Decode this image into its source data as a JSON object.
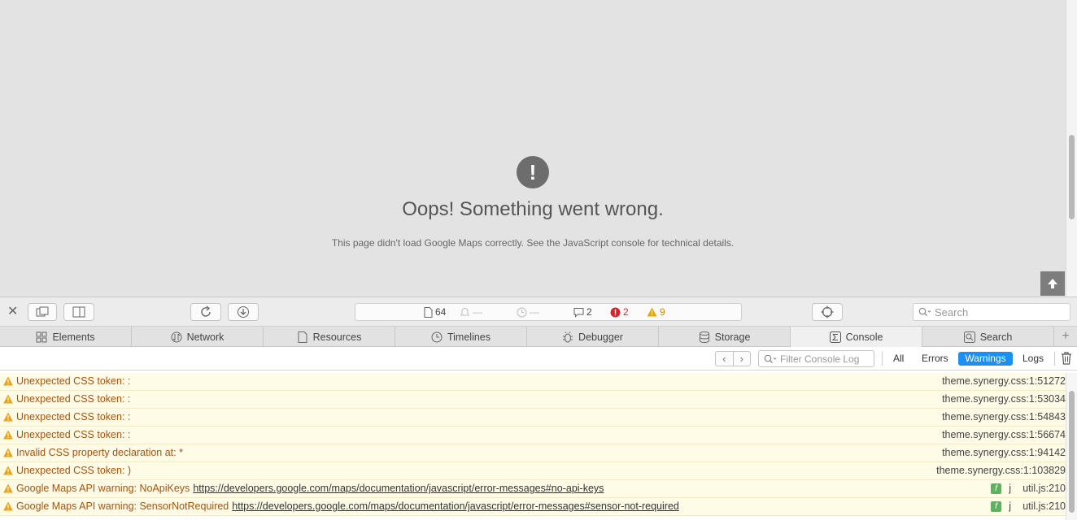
{
  "page": {
    "error_icon": "!",
    "error_title": "Oops! Something went wrong.",
    "error_description": "This page didn't load Google Maps correctly. See the JavaScript console for technical details."
  },
  "toolbar": {
    "resources_count": "64",
    "network_value": "—",
    "load_time_value": "—",
    "logs_count": "2",
    "errors_count": "2",
    "warnings_count": "9",
    "search_placeholder": "Search"
  },
  "tabs": [
    {
      "label": "Elements",
      "icon": "elements-icon"
    },
    {
      "label": "Network",
      "icon": "network-icon"
    },
    {
      "label": "Resources",
      "icon": "resources-icon"
    },
    {
      "label": "Timelines",
      "icon": "timelines-icon"
    },
    {
      "label": "Debugger",
      "icon": "debugger-icon"
    },
    {
      "label": "Storage",
      "icon": "storage-icon"
    },
    {
      "label": "Console",
      "icon": "console-icon",
      "active": true
    },
    {
      "label": "Search",
      "icon": "search-icon"
    }
  ],
  "filter": {
    "placeholder": "Filter Console Log",
    "scopes": [
      "All",
      "Errors",
      "Warnings",
      "Logs"
    ],
    "active_scope": "Warnings"
  },
  "messages": [
    {
      "text": "Unexpected CSS token: :",
      "source": "theme.synergy.css:1:51272"
    },
    {
      "text": "Unexpected CSS token: :",
      "source": "theme.synergy.css:1:53034"
    },
    {
      "text": "Unexpected CSS token: :",
      "source": "theme.synergy.css:1:54843"
    },
    {
      "text": "Unexpected CSS token: :",
      "source": "theme.synergy.css:1:56674"
    },
    {
      "text": "Invalid CSS property declaration at: *",
      "source": "theme.synergy.css:1:94142"
    },
    {
      "text": "Unexpected CSS token: )",
      "source": "theme.synergy.css:1:103829"
    },
    {
      "text": "Google Maps API warning: NoApiKeys",
      "link": "https://developers.google.com/maps/documentation/javascript/error-messages#no-api-keys",
      "function": "j",
      "source": "util.js:210"
    },
    {
      "text": "Google Maps API warning: SensorNotRequired",
      "link": "https://developers.google.com/maps/documentation/javascript/error-messages#sensor-not-required",
      "function": "j",
      "source": "util.js:210"
    }
  ],
  "colors": {
    "warning_row_bg": "#fefbe6",
    "warning_text": "#a3540f",
    "active_scope": "#1e8ff1",
    "error_badge": "#d8232f",
    "warning_badge": "#e8a317"
  }
}
